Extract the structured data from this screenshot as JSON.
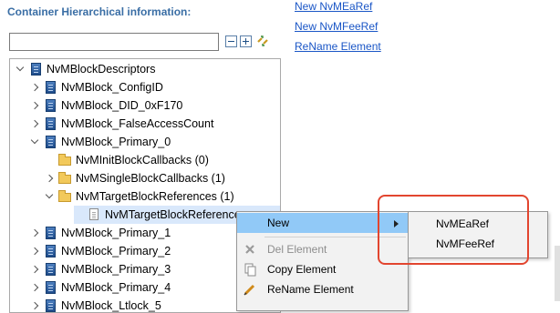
{
  "panel": {
    "title": "Container Hierarchical information:"
  },
  "links": [
    "New NvMEaRef",
    "New NvMFeeRef",
    "ReName Element"
  ],
  "filter": {
    "value": "",
    "placeholder": ""
  },
  "toolbar": {
    "collapse_icon": "collapse-all-icon",
    "expand_icon": "expand-all-icon",
    "sync_icon": "link-with-editor-icon"
  },
  "tree": {
    "rows": [
      {
        "label": "NvMBlockDescriptors",
        "level": 0,
        "twisty": "open",
        "icon": "block-icon"
      },
      {
        "label": "NvMBlock_ConfigID",
        "level": 1,
        "twisty": "closed",
        "icon": "block-icon"
      },
      {
        "label": "NvMBlock_DID_0xF170",
        "level": 1,
        "twisty": "closed",
        "icon": "block-icon"
      },
      {
        "label": "NvMBlock_FalseAccessCount",
        "level": 1,
        "twisty": "closed",
        "icon": "block-icon"
      },
      {
        "label": "NvMBlock_Primary_0",
        "level": 1,
        "twisty": "open",
        "icon": "block-icon"
      },
      {
        "label": "NvMInitBlockCallbacks (0)",
        "level": 2,
        "twisty": "none",
        "icon": "folder-icon"
      },
      {
        "label": "NvMSingleBlockCallbacks (1)",
        "level": 2,
        "twisty": "closed",
        "icon": "folder-icon"
      },
      {
        "label": "NvMTargetBlockReferences (1)",
        "level": 2,
        "twisty": "open",
        "icon": "folder-icon"
      },
      {
        "label": "NvMTargetBlockReference",
        "level": 3,
        "twisty": "none",
        "icon": "file-icon",
        "selected": true
      },
      {
        "label": "NvMBlock_Primary_1",
        "level": 1,
        "twisty": "closed",
        "icon": "block-icon"
      },
      {
        "label": "NvMBlock_Primary_2",
        "level": 1,
        "twisty": "closed",
        "icon": "block-icon"
      },
      {
        "label": "NvMBlock_Primary_3",
        "level": 1,
        "twisty": "closed",
        "icon": "block-icon"
      },
      {
        "label": "NvMBlock_Primary_4",
        "level": 1,
        "twisty": "closed",
        "icon": "block-icon"
      },
      {
        "label": "NvMBlock_Ltlock_5",
        "level": 1,
        "twisty": "closed",
        "icon": "block-icon"
      }
    ]
  },
  "context_menu": {
    "items": [
      {
        "label": "New",
        "icon": "",
        "highlighted": true,
        "disabled": false,
        "submenu": true
      },
      {
        "label": "Del Element",
        "icon": "delete-icon",
        "highlighted": false,
        "disabled": true,
        "submenu": false
      },
      {
        "label": "Copy Element",
        "icon": "copy-icon",
        "highlighted": false,
        "disabled": false,
        "submenu": false
      },
      {
        "label": "ReName Element",
        "icon": "rename-icon",
        "highlighted": false,
        "disabled": false,
        "submenu": false
      }
    ]
  },
  "submenu": {
    "items": [
      {
        "label": "NvMEaRef"
      },
      {
        "label": "NvMFeeRef"
      }
    ]
  },
  "colors": {
    "title_blue": "#3a6ea5",
    "link_blue": "#1a56c6",
    "menu_highlight": "#91c9f7",
    "selection": "#d9e8fb",
    "annotation_red": "#e2452f"
  }
}
